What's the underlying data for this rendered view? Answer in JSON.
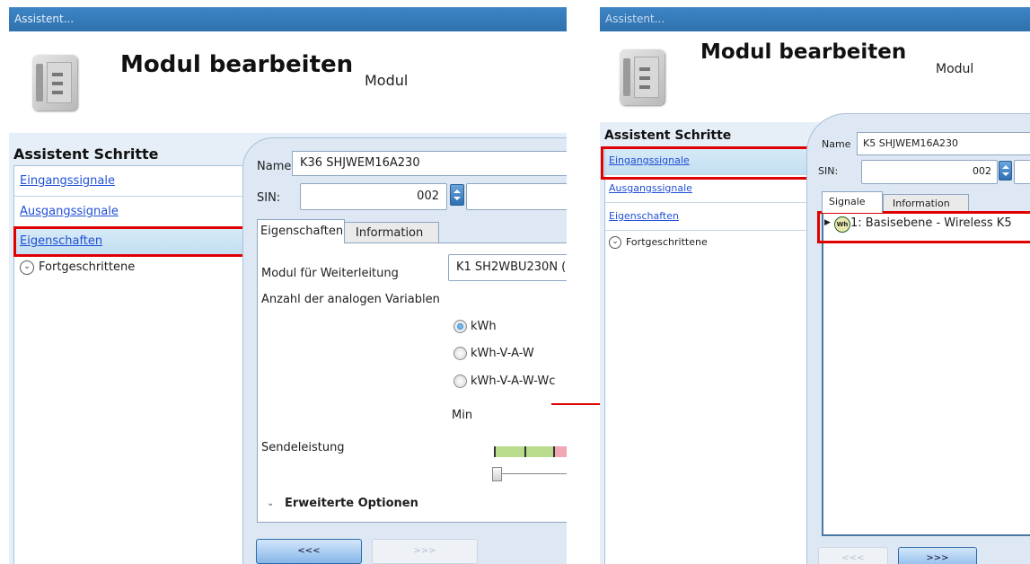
{
  "left_window": {
    "title": "Assistent...",
    "heading": "Modul bearbeiten",
    "subheading": "Modul",
    "steps_title": "Assistent Schritte",
    "steps": [
      {
        "label": "Eingangssignale"
      },
      {
        "label": "Ausgangssignale"
      },
      {
        "label": "Eigenschaften"
      }
    ],
    "advanced": "Fortgeschrittene",
    "form": {
      "name_label": "Name",
      "name_value": "K36 SHJWEM16A230",
      "sin_label": "SIN:",
      "sin_value": "002"
    },
    "tabs": [
      "Eigenschaften",
      "Information"
    ],
    "props": {
      "forward_label": "Modul für Weiterleitung",
      "forward_value": "K1 SH2WBU230N (",
      "analog_label": "Anzahl der analogen Variablen",
      "options": [
        "kWh",
        "kWh-V-A-W",
        "kWh-V-A-W-Wc"
      ],
      "selected_option": "kWh",
      "min_label": "Min",
      "power_label": "Sendeleistung",
      "extended": "Erweiterte Optionen"
    },
    "buttons": {
      "back": "<<<",
      "next": ">>>"
    }
  },
  "right_window": {
    "title": "Assistent...",
    "heading": "Modul bearbeiten",
    "subheading": "Modul",
    "steps_title": "Assistent Schritte",
    "steps": [
      {
        "label": "Eingangssignale"
      },
      {
        "label": "Ausgangssignale"
      },
      {
        "label": "Eigenschaften"
      }
    ],
    "advanced": "Fortgeschrittene",
    "form": {
      "name_label": "Name",
      "name_value": "K5 SHJWEM16A230",
      "sin_label": "SIN:",
      "sin_value": "002"
    },
    "tabs": [
      "Signale",
      "Information"
    ],
    "signal_item": {
      "badge": "Wh",
      "label": "1: Basisebene - Wireless K5"
    },
    "buttons": {
      "back": "<<<",
      "next": ">>>"
    }
  },
  "colors": {
    "titlebar": "#2f71ad",
    "highlight": "#e00000",
    "link": "#1f4fd6",
    "panel": "#dde8f4"
  }
}
